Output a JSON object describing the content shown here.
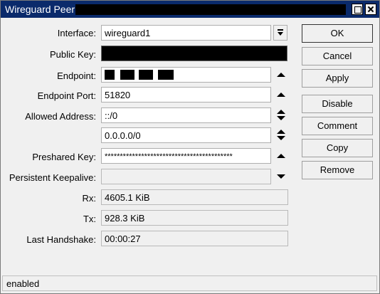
{
  "window": {
    "title": "Wireguard Peer"
  },
  "form": {
    "interface": {
      "label": "Interface:",
      "value": "wireguard1"
    },
    "public_key": {
      "label": "Public Key:"
    },
    "endpoint": {
      "label": "Endpoint:"
    },
    "endpoint_port": {
      "label": "Endpoint Port:",
      "value": "51820"
    },
    "allowed_address": {
      "label": "Allowed Address:",
      "values": [
        "::/0",
        "0.0.0.0/0"
      ]
    },
    "preshared_key": {
      "label": "Preshared Key:",
      "value": "******************************************"
    },
    "persistent_keepalive": {
      "label": "Persistent Keepalive:",
      "value": ""
    },
    "rx": {
      "label": "Rx:",
      "value": "4605.1 KiB"
    },
    "tx": {
      "label": "Tx:",
      "value": "928.3 KiB"
    },
    "last_handshake": {
      "label": "Last Handshake:",
      "value": "00:00:27"
    }
  },
  "buttons": {
    "ok": "OK",
    "cancel": "Cancel",
    "apply": "Apply",
    "disable": "Disable",
    "comment": "Comment",
    "copy": "Copy",
    "remove": "Remove"
  },
  "status": {
    "text": "enabled"
  },
  "icons": {
    "dropdown": "dropdown-arrow-icon",
    "expand_up": "triangle-up-icon",
    "expand_down": "triangle-down-icon",
    "minimize": "window-restore-icon",
    "close": "close-icon"
  }
}
